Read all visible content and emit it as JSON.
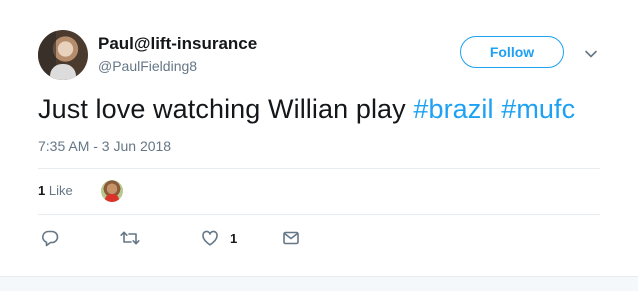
{
  "user": {
    "display_name": "Paul@lift-insurance",
    "handle": "@PaulFielding8"
  },
  "follow_button": {
    "label": "Follow"
  },
  "tweet": {
    "text_plain": "Just love watching Willian play ",
    "hashtags": [
      "#brazil",
      "#mufc"
    ],
    "timestamp": "7:35 AM - 3 Jun 2018"
  },
  "stats": {
    "likes_count": "1",
    "likes_label": "Like"
  },
  "actions": {
    "reply_icon": "reply-icon",
    "retweet_icon": "retweet-icon",
    "like_icon": "heart-icon",
    "like_count": "1",
    "dm_icon": "envelope-icon"
  },
  "colors": {
    "accent": "#1da1f2",
    "text": "#14171a",
    "muted": "#657786",
    "divider": "#e6ecf0"
  }
}
